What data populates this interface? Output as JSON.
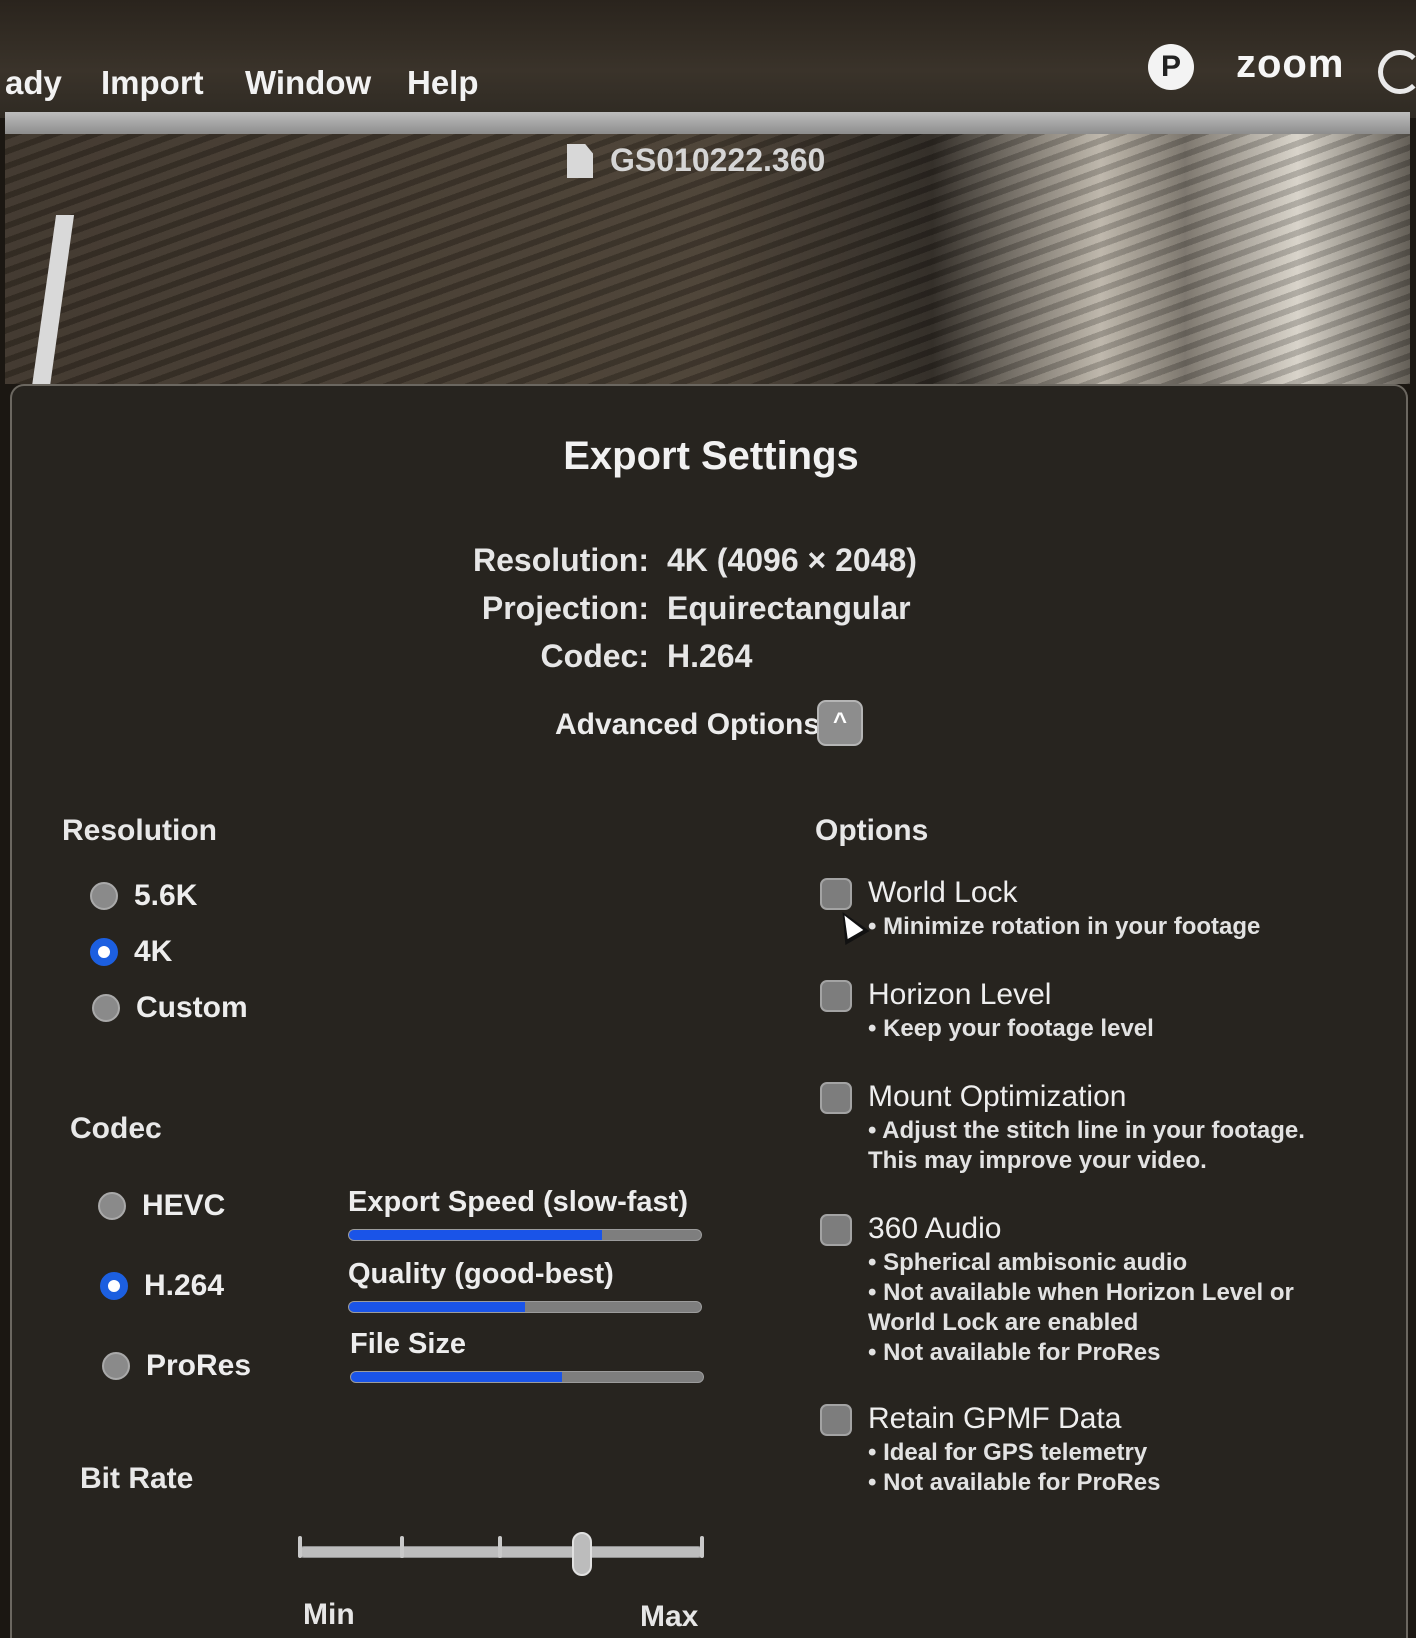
{
  "menubar": {
    "items": [
      "ady",
      "Import",
      "Window",
      "Help"
    ],
    "status": {
      "zoom_label": "zoom",
      "p_badge": "P"
    }
  },
  "video": {
    "filename": "GS010222.360"
  },
  "dialog": {
    "title": "Export Settings",
    "summary": [
      {
        "label": "Resolution:",
        "value": "4K (4096 × 2048)"
      },
      {
        "label": "Projection:",
        "value": "Equirectangular"
      },
      {
        "label": "Codec:",
        "value": "H.264"
      }
    ],
    "advanced_options_label": "Advanced Options",
    "advanced_toggle_glyph": "^",
    "resolution": {
      "heading": "Resolution",
      "options": [
        {
          "label": "5.6K",
          "selected": false
        },
        {
          "label": "4K",
          "selected": true
        },
        {
          "label": "Custom",
          "selected": false
        }
      ]
    },
    "codec": {
      "heading": "Codec",
      "options": [
        {
          "label": "HEVC",
          "selected": false
        },
        {
          "label": "H.264",
          "selected": true
        },
        {
          "label": "ProRes",
          "selected": false
        }
      ]
    },
    "meters": [
      {
        "label": "Export Speed (slow-fast)",
        "level": 0.72
      },
      {
        "label": "Quality (good-best)",
        "level": 0.5
      },
      {
        "label": "File Size",
        "level": 0.6
      }
    ],
    "bitrate": {
      "heading": "Bit Rate",
      "min_label": "Min",
      "max_label": "Max",
      "level": 0.7
    },
    "options": {
      "heading": "Options",
      "items": [
        {
          "title": "World Lock",
          "desc": [
            "• Minimize rotation in your footage"
          ],
          "checked": false
        },
        {
          "title": "Horizon Level",
          "desc": [
            "• Keep your footage level"
          ],
          "checked": false
        },
        {
          "title": "Mount Optimization",
          "desc": [
            "• Adjust the stitch line in your footage.",
            "This may improve your video."
          ],
          "checked": false
        },
        {
          "title": "360 Audio",
          "desc": [
            "• Spherical ambisonic audio",
            "• Not available when Horizon Level or",
            "World Lock are enabled",
            "• Not available for ProRes"
          ],
          "checked": false
        },
        {
          "title": "Retain GPMF Data",
          "desc": [
            "• Ideal for GPS telemetry",
            "• Not available for ProRes"
          ],
          "checked": false
        }
      ]
    }
  }
}
